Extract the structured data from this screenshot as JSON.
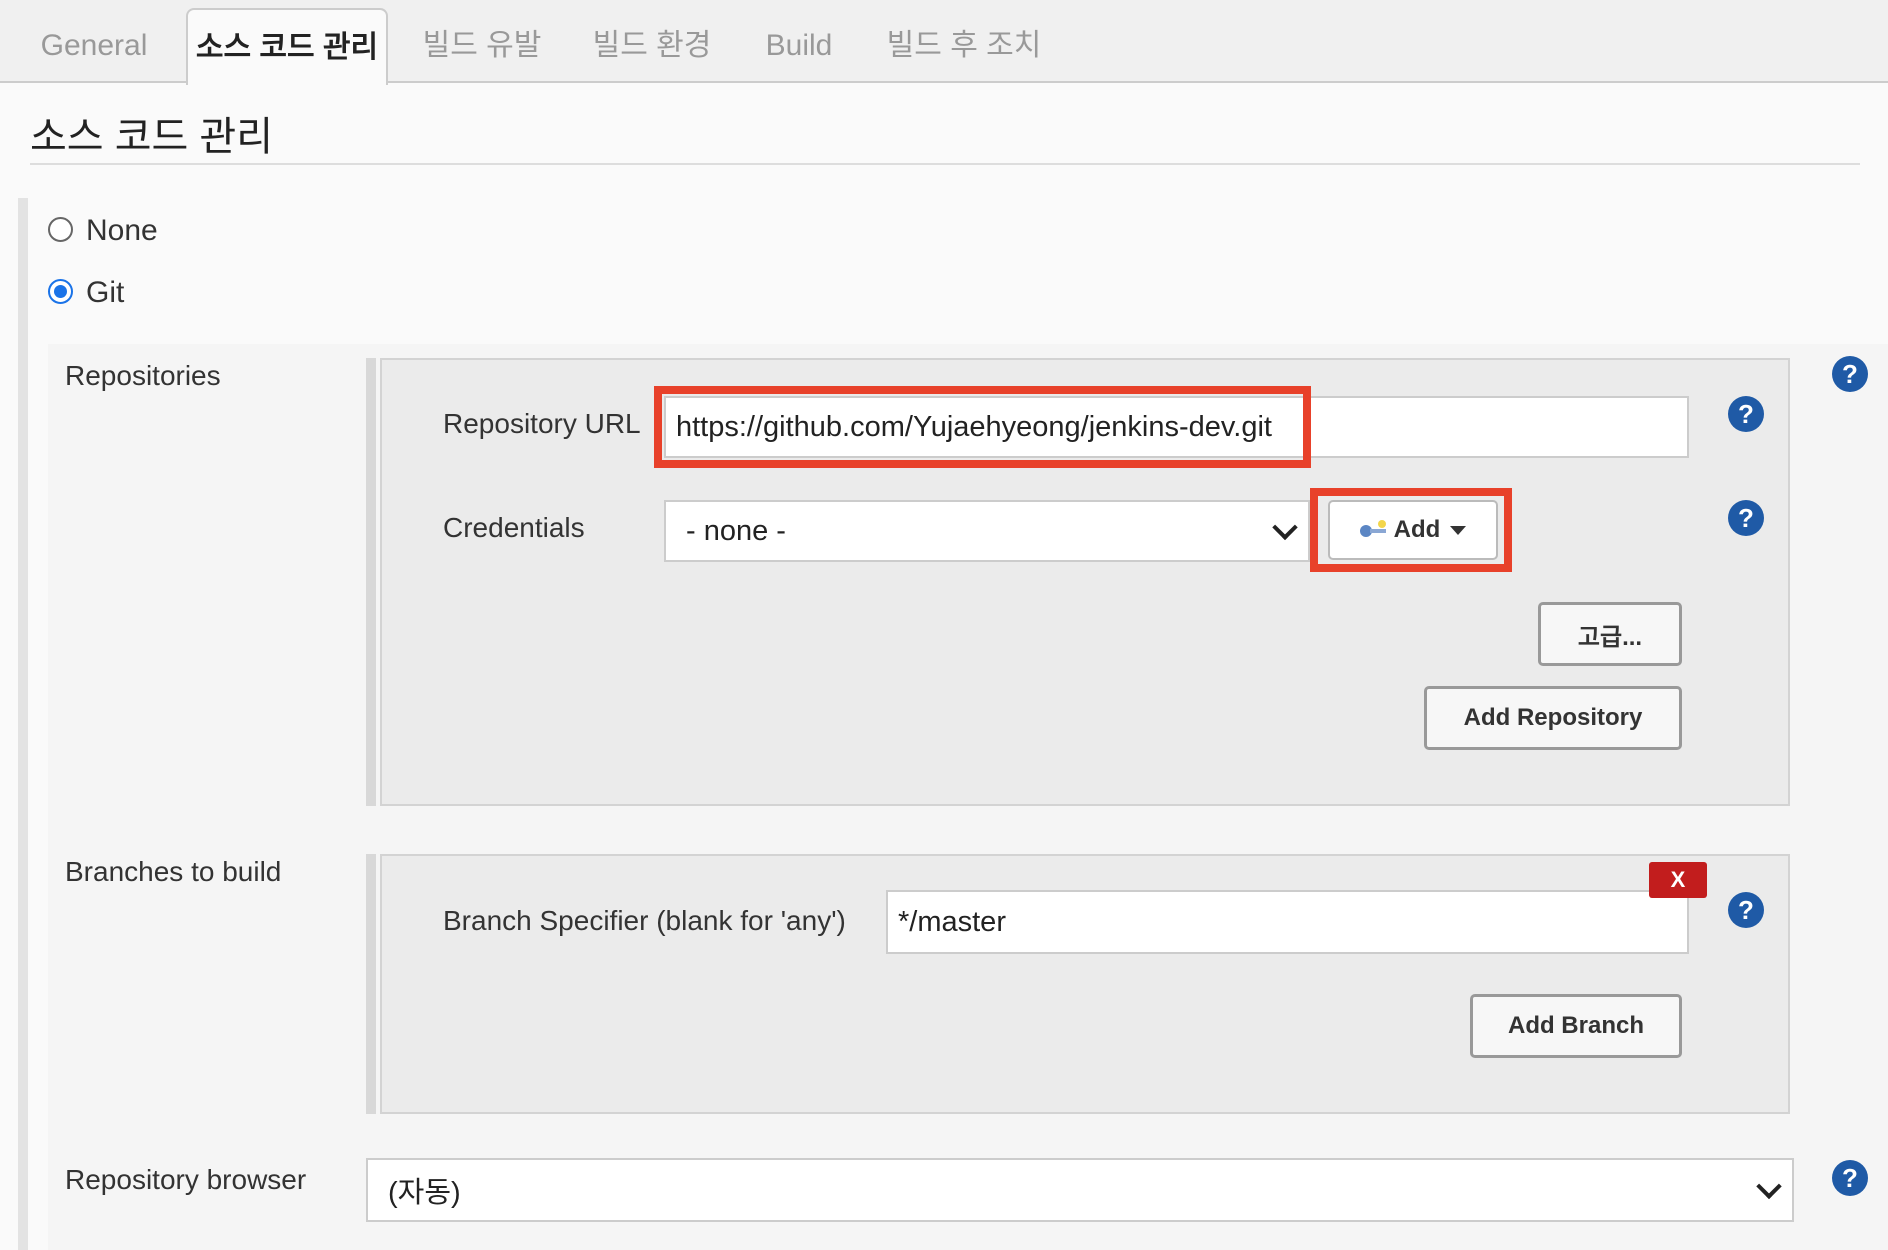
{
  "tabs": [
    {
      "label": "General"
    },
    {
      "label": "소스 코드 관리"
    },
    {
      "label": "빌드 유발"
    },
    {
      "label": "빌드 환경"
    },
    {
      "label": "Build"
    },
    {
      "label": "빌드 후 조치"
    }
  ],
  "active_tab": "소스 코드 관리",
  "section_title": "소스 코드 관리",
  "scm_options": [
    {
      "label": "None",
      "selected": false
    },
    {
      "label": "Git",
      "selected": true
    }
  ],
  "repositories": {
    "label": "Repositories",
    "url_label": "Repository URL",
    "url_value": "https://github.com/Yujaehyeong/jenkins-dev.git",
    "credentials_label": "Credentials",
    "credentials_value": "- none -",
    "add_button": "Add",
    "advanced_button": "고급...",
    "add_repository_button": "Add Repository"
  },
  "branches": {
    "label": "Branches to build",
    "specifier_label": "Branch Specifier (blank for 'any')",
    "specifier_value": "*/master",
    "delete_button": "X",
    "add_branch_button": "Add Branch"
  },
  "repository_browser": {
    "label": "Repository browser",
    "value": "(자동)"
  },
  "help_symbol": "?",
  "colors": {
    "highlight": "#e8412a",
    "help_icon": "#1f5aa6",
    "delete_button": "#c21d1d",
    "radio_checked": "#1a73e8"
  }
}
